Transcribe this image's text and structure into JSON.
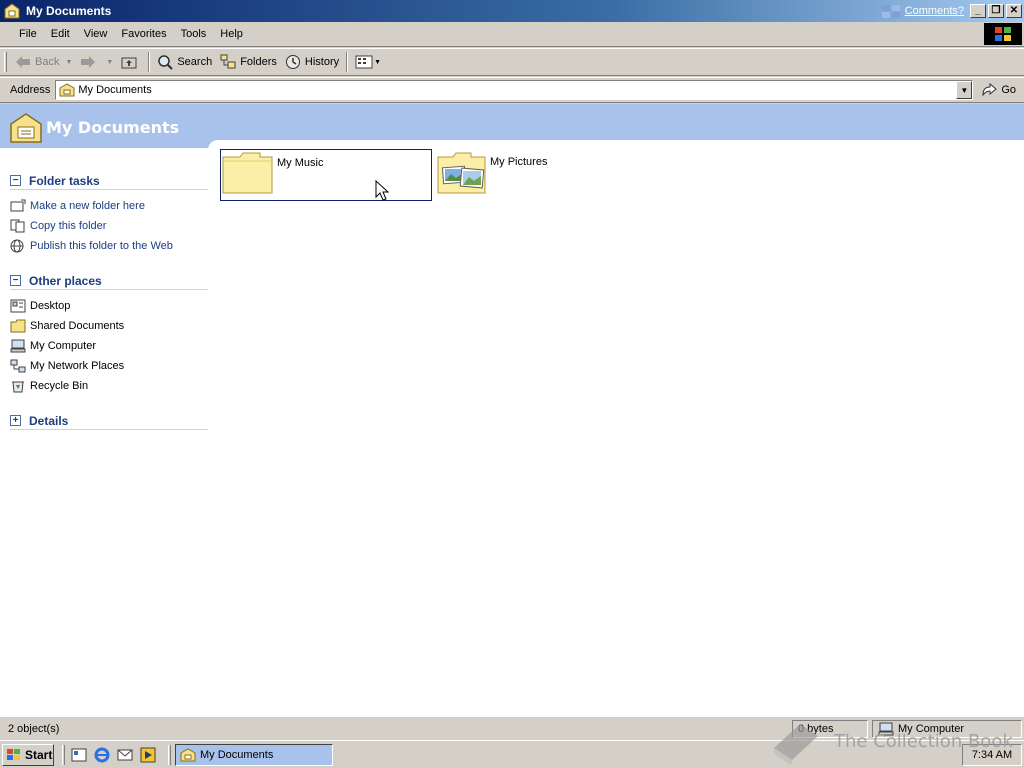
{
  "window": {
    "title": "My Documents",
    "comments_link": "Comments?",
    "buttons": {
      "minimize": "_",
      "restore": "❐",
      "close": "✕"
    }
  },
  "menu": {
    "items": [
      "File",
      "Edit",
      "View",
      "Favorites",
      "Tools",
      "Help"
    ]
  },
  "toolbar": {
    "back": "Back",
    "search": "Search",
    "folders": "Folders",
    "history": "History"
  },
  "address": {
    "label": "Address",
    "value": "My Documents",
    "go": "Go"
  },
  "banner": {
    "title": "My Documents"
  },
  "sidebar": {
    "folder_tasks": {
      "title": "Folder tasks",
      "toggle": "−",
      "items": [
        "Make a new folder here",
        "Copy this folder",
        "Publish this folder to the Web"
      ]
    },
    "other_places": {
      "title": "Other places",
      "toggle": "−",
      "items": [
        "Desktop",
        "Shared Documents",
        "My Computer",
        "My Network Places",
        "Recycle Bin"
      ]
    },
    "details": {
      "title": "Details",
      "toggle": "+"
    }
  },
  "files": [
    {
      "name": "My Music",
      "selected": true
    },
    {
      "name": "My Pictures",
      "selected": false
    }
  ],
  "statusbar": {
    "objects": "2 object(s)",
    "size": "0 bytes",
    "zone": "My Computer"
  },
  "taskbar": {
    "start": "Start",
    "task": "My Documents",
    "clock": "7:34 AM"
  },
  "watermark": "The Collection Book",
  "colors": {
    "title_start": "#0a246a",
    "banner": "#a8c2ec",
    "link": "#1c3d80"
  }
}
